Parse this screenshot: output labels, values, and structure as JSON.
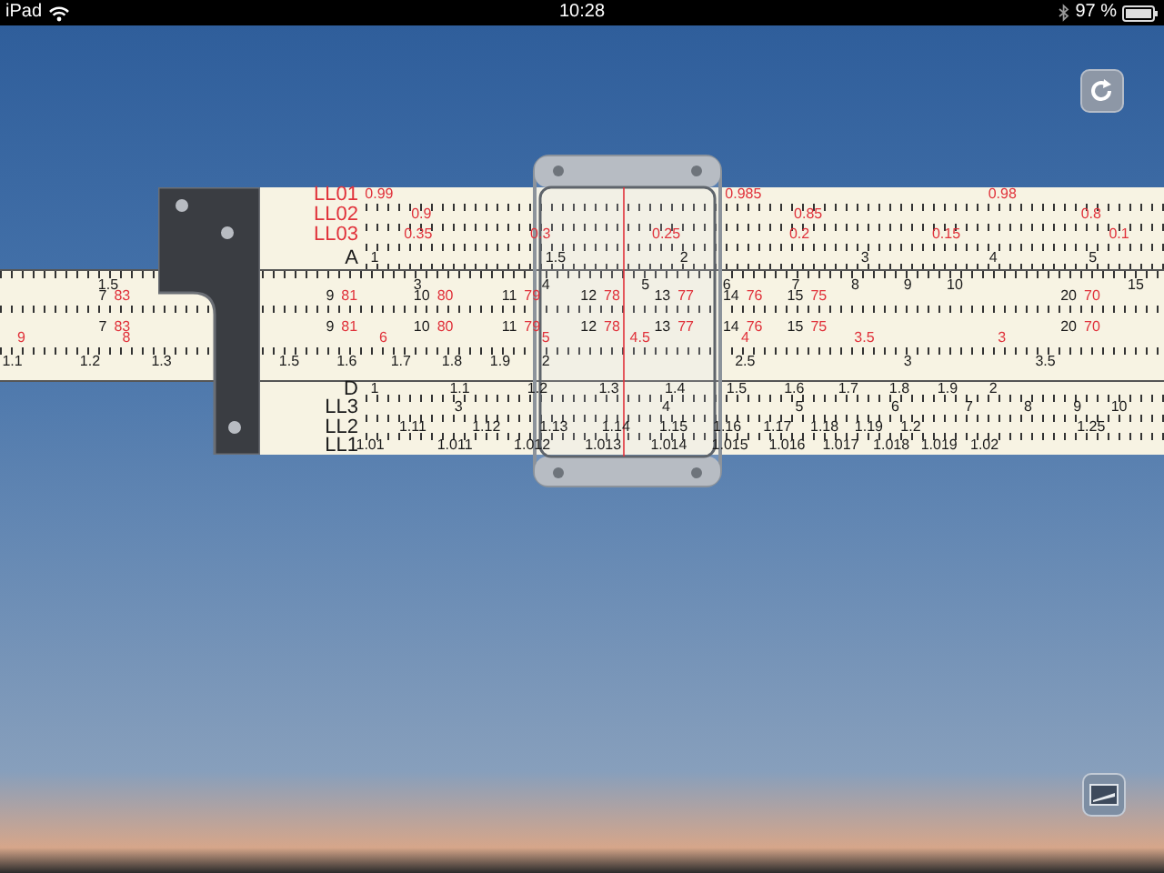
{
  "status_bar": {
    "device": "iPad",
    "time": "10:28",
    "battery": "97 %"
  },
  "rule": {
    "stator_top": [
      {
        "name": "LL01",
        "kind": "ll01",
        "color": "#e0313a",
        "labels": [
          "0.99",
          "0.985",
          "0.98"
        ]
      },
      {
        "name": "LL02",
        "kind": "ll02",
        "color": "#e0313a",
        "labels": [
          "0.9",
          "0.85",
          "0.8"
        ]
      },
      {
        "name": "LL03",
        "kind": "ll03",
        "color": "#e0313a",
        "labels": [
          "0.35",
          "0.3",
          "0.25",
          "0.2",
          "0.15",
          "0.1"
        ]
      },
      {
        "name": "A",
        "kind": "a",
        "color": "#1a1a1a",
        "labels": [
          "1",
          "1.5",
          "2",
          "3",
          "4",
          "5"
        ]
      }
    ],
    "slide": [
      {
        "kind": "b",
        "color": "#1a1a1a",
        "labels": [
          "1.5",
          "3",
          "4",
          "5",
          "6",
          "7",
          "8",
          "9",
          "10",
          "15"
        ]
      },
      {
        "kind": "t",
        "color": "#1a1a1a",
        "labels": [
          {
            "value": "7",
            "complement": "83"
          },
          {
            "value": "9",
            "complement": "81"
          },
          {
            "value": "10",
            "complement": "80"
          },
          {
            "value": "11",
            "complement": "79"
          },
          {
            "value": "12",
            "complement": "78"
          },
          {
            "value": "13",
            "complement": "77"
          },
          {
            "value": "14",
            "complement": "76"
          },
          {
            "value": "15",
            "complement": "75"
          },
          {
            "value": "20",
            "complement": "70"
          }
        ]
      },
      {
        "kind": "t",
        "color": "#1a1a1a",
        "labels": [
          {
            "value": "7",
            "complement": "83"
          },
          {
            "value": "9",
            "complement": "81"
          },
          {
            "value": "10",
            "complement": "80"
          },
          {
            "value": "11",
            "complement": "79"
          },
          {
            "value": "12",
            "complement": "78"
          },
          {
            "value": "13",
            "complement": "77"
          },
          {
            "value": "14",
            "complement": "76"
          },
          {
            "value": "15",
            "complement": "75"
          },
          {
            "value": "20",
            "complement": "70"
          }
        ]
      },
      {
        "kind": "ci",
        "color": "#e0313a",
        "labels": [
          "9",
          "8",
          "6",
          "5",
          "4.5",
          "4",
          "3.5",
          "3"
        ]
      },
      {
        "kind": "c",
        "color": "#1a1a1a",
        "labels": [
          "1.1",
          "1.2",
          "1.3",
          "1.5",
          "1.6",
          "1.7",
          "1.8",
          "1.9",
          "2",
          "2.5",
          "3",
          "3.5"
        ]
      }
    ],
    "stator_bottom": [
      {
        "name": "D",
        "kind": "d",
        "color": "#1a1a1a",
        "labels": [
          "1",
          "1.1",
          "1.2",
          "1.3",
          "1.4",
          "1.5",
          "1.6",
          "1.7",
          "1.8",
          "1.9",
          "2"
        ]
      },
      {
        "name": "LL3",
        "kind": "ll3",
        "color": "#1a1a1a",
        "labels": [
          "3",
          "4",
          "5",
          "6",
          "7",
          "8",
          "9",
          "10"
        ]
      },
      {
        "name": "LL2",
        "kind": "ll2",
        "color": "#1a1a1a",
        "labels": [
          "1.11",
          "1.12",
          "1.13",
          "1.14",
          "1.15",
          "1.16",
          "1.17",
          "1.18",
          "1.19",
          "1.2",
          "1.25"
        ]
      },
      {
        "name": "LL1",
        "kind": "ll1",
        "color": "#1a1a1a",
        "labels": [
          "1.01",
          "1.011",
          "1.012",
          "1.013",
          "1.014",
          "1.015",
          "1.016",
          "1.017",
          "1.018",
          "1.019",
          "1.02"
        ]
      }
    ]
  }
}
